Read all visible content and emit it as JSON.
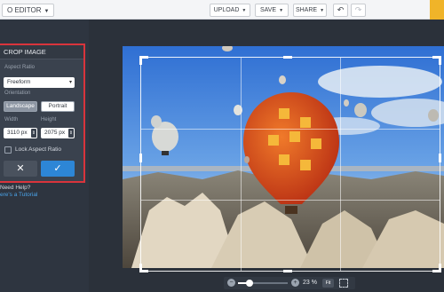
{
  "topbar": {
    "app_title": "O EDITOR",
    "upload_label": "UPLOAD",
    "save_label": "SAVE",
    "share_label": "SHARE",
    "undo_icon": "undo-icon",
    "redo_icon": "redo-icon"
  },
  "crop_panel": {
    "title": "CROP IMAGE",
    "aspect_ratio_label": "Aspect Ratio",
    "aspect_ratio_value": "Freeform",
    "orientation_label": "Orientation",
    "landscape_label": "Landscape",
    "portrait_label": "Portrait",
    "width_label": "Width",
    "height_label": "Height",
    "width_value": "3110 px",
    "height_value": "2075 px",
    "lock_label": "Lock Aspect Ratio",
    "lock_checked": false,
    "cancel_icon": "close-icon",
    "apply_icon": "checkmark-icon"
  },
  "help": {
    "question": "Need Help?",
    "link": "ere's a Tutorial"
  },
  "zoom": {
    "label": "23 %",
    "value_fraction": 0.23,
    "fit_label": "Fit"
  },
  "colors": {
    "accent_blue": "#2d86d6",
    "highlight_red": "#d9343c",
    "panel_dark": "#3a424e",
    "corner_yellow": "#f0b429"
  }
}
